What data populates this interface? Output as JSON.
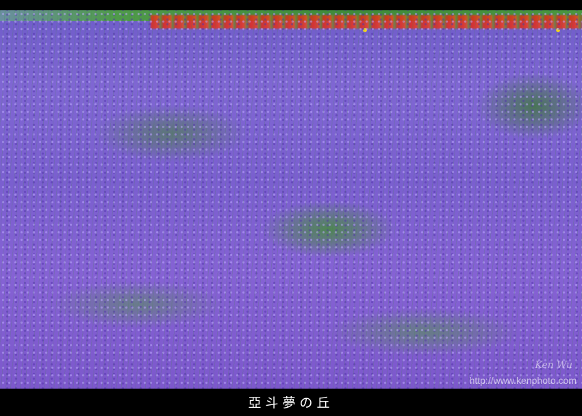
{
  "photo": {
    "description_colors": {
      "lavender": "#7f66d3",
      "foliage": "#4f9a4a",
      "red_flowers": "#e0281a",
      "yellow_flowers": "#f2d322",
      "frame": "#000000"
    },
    "watermark_signature": "Ken Wu",
    "watermark_url": "http://www.kenphoto.com"
  },
  "caption": {
    "text": "亞斗夢の丘"
  }
}
